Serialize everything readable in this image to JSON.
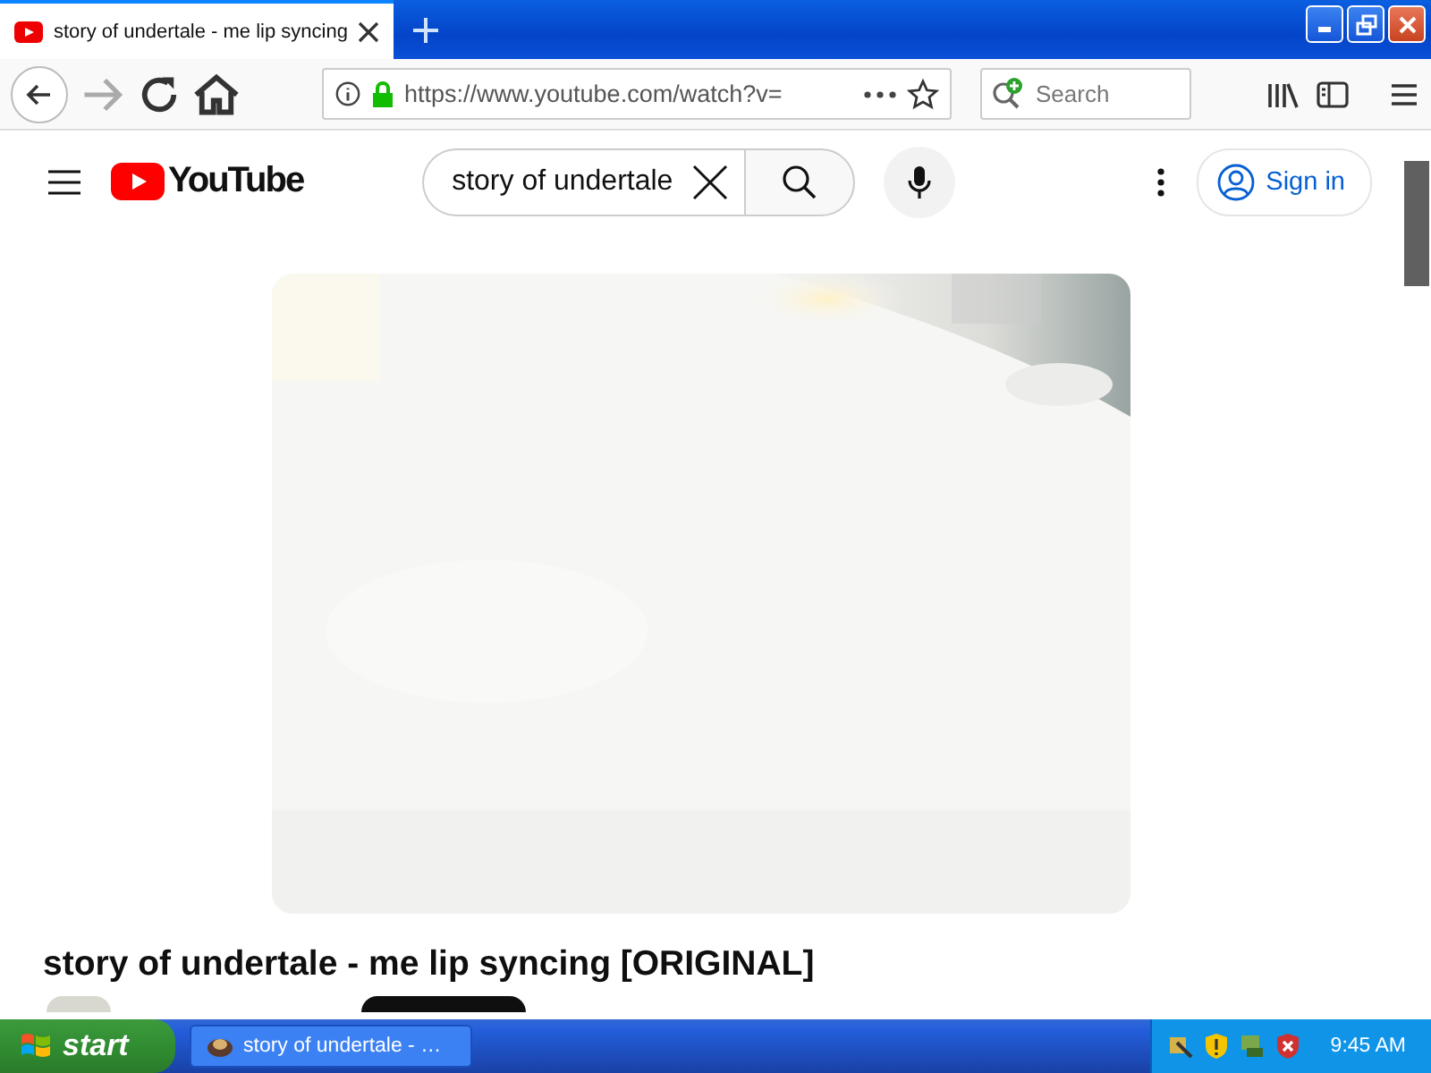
{
  "browser": {
    "tabs": [
      {
        "title": "story of undertale - me lip syncing",
        "selected": true
      }
    ],
    "url": "https://www.youtube.com/watch?v=",
    "search": {
      "placeholder": "Search"
    }
  },
  "youtube": {
    "logo": "YouTube",
    "search": {
      "value": "story of undertale"
    },
    "sign_in": "Sign in"
  },
  "video": {
    "kind": "picture",
    "title": "story of undertale - me lip syncing [ORIGINAL]"
  },
  "taskbar": {
    "start": "start",
    "tasks": [
      {
        "label": "story of undertale - …"
      }
    ],
    "clock": "9:45 AM"
  }
}
